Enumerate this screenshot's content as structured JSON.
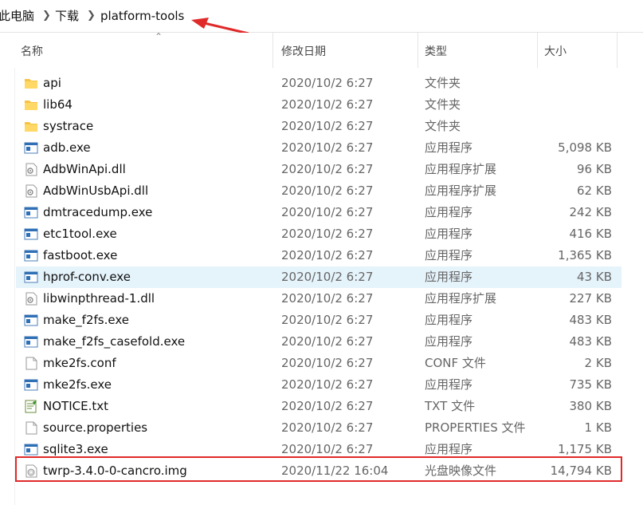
{
  "breadcrumb": [
    "此电脑",
    "下载",
    "platform-tools"
  ],
  "columns": {
    "name": "名称",
    "date": "修改日期",
    "type": "类型",
    "size": "大小"
  },
  "colors": {
    "selected_row": "#e5f3fb",
    "annotation_red": "#e02a2a"
  },
  "files": [
    {
      "name": "api",
      "date": "2020/10/2 6:27",
      "type": "文件夹",
      "size": "",
      "icon": "folder-icon"
    },
    {
      "name": "lib64",
      "date": "2020/10/2 6:27",
      "type": "文件夹",
      "size": "",
      "icon": "folder-icon"
    },
    {
      "name": "systrace",
      "date": "2020/10/2 6:27",
      "type": "文件夹",
      "size": "",
      "icon": "folder-icon"
    },
    {
      "name": "adb.exe",
      "date": "2020/10/2 6:27",
      "type": "应用程序",
      "size": "5,098 KB",
      "icon": "exe-icon"
    },
    {
      "name": "AdbWinApi.dll",
      "date": "2020/10/2 6:27",
      "type": "应用程序扩展",
      "size": "96 KB",
      "icon": "dll-icon"
    },
    {
      "name": "AdbWinUsbApi.dll",
      "date": "2020/10/2 6:27",
      "type": "应用程序扩展",
      "size": "62 KB",
      "icon": "dll-icon"
    },
    {
      "name": "dmtracedump.exe",
      "date": "2020/10/2 6:27",
      "type": "应用程序",
      "size": "242 KB",
      "icon": "exe-icon"
    },
    {
      "name": "etc1tool.exe",
      "date": "2020/10/2 6:27",
      "type": "应用程序",
      "size": "416 KB",
      "icon": "exe-icon"
    },
    {
      "name": "fastboot.exe",
      "date": "2020/10/2 6:27",
      "type": "应用程序",
      "size": "1,365 KB",
      "icon": "exe-icon"
    },
    {
      "name": "hprof-conv.exe",
      "date": "2020/10/2 6:27",
      "type": "应用程序",
      "size": "43 KB",
      "icon": "exe-icon",
      "selected": true
    },
    {
      "name": "libwinpthread-1.dll",
      "date": "2020/10/2 6:27",
      "type": "应用程序扩展",
      "size": "227 KB",
      "icon": "dll-icon"
    },
    {
      "name": "make_f2fs.exe",
      "date": "2020/10/2 6:27",
      "type": "应用程序",
      "size": "483 KB",
      "icon": "exe-icon"
    },
    {
      "name": "make_f2fs_casefold.exe",
      "date": "2020/10/2 6:27",
      "type": "应用程序",
      "size": "483 KB",
      "icon": "exe-icon"
    },
    {
      "name": "mke2fs.conf",
      "date": "2020/10/2 6:27",
      "type": "CONF 文件",
      "size": "2 KB",
      "icon": "file-icon"
    },
    {
      "name": "mke2fs.exe",
      "date": "2020/10/2 6:27",
      "type": "应用程序",
      "size": "735 KB",
      "icon": "exe-icon"
    },
    {
      "name": "NOTICE.txt",
      "date": "2020/10/2 6:27",
      "type": "TXT 文件",
      "size": "380 KB",
      "icon": "txt-icon"
    },
    {
      "name": "source.properties",
      "date": "2020/10/2 6:27",
      "type": "PROPERTIES 文件",
      "size": "1 KB",
      "icon": "file-icon"
    },
    {
      "name": "sqlite3.exe",
      "date": "2020/10/2 6:27",
      "type": "应用程序",
      "size": "1,175 KB",
      "icon": "exe-icon"
    },
    {
      "name": "twrp-3.4.0-0-cancro.img",
      "date": "2020/11/22 16:04",
      "type": "光盘映像文件",
      "size": "14,794 KB",
      "icon": "disc-image-icon",
      "highlighted": true
    }
  ]
}
